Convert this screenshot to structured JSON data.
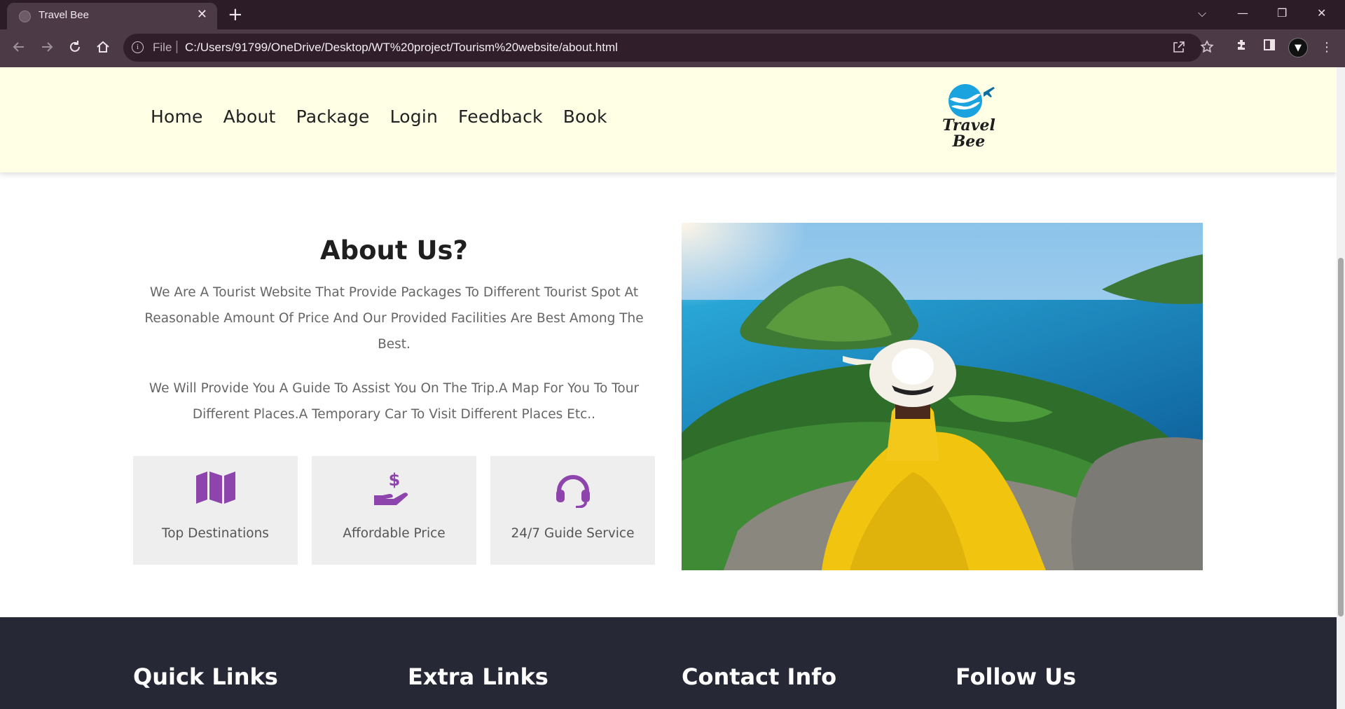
{
  "browser": {
    "tab_title": "Travel Bee",
    "tab_close": "✕",
    "new_tab": "+",
    "address_label": "File",
    "address_sep": "|",
    "url": "C:/Users/91799/OneDrive/Desktop/WT%20project/Tourism%20website/about.html",
    "window_controls": [
      "⌵",
      "—",
      "❐",
      "✕"
    ],
    "nav_icons": [
      "back-icon",
      "forward-icon",
      "reload-icon",
      "home-icon"
    ],
    "toolbar_icons": [
      "share-icon",
      "star-icon",
      "extensions-icon",
      "sidebar-icon",
      "profile-icon",
      "menu-icon"
    ]
  },
  "header": {
    "nav": [
      "Home",
      "About",
      "Package",
      "Login",
      "Feedback",
      "Book"
    ],
    "logo_line1": "Travel",
    "logo_line2": "Bee"
  },
  "about": {
    "title": "About Us?",
    "paragraph1": "We Are A Tourist Website That Provide Packages To Different Tourist Spot At Reasonable Amount Of Price And Our Provided Facilities Are Best Among The Best.",
    "paragraph2": "We Will Provide You A Guide To Assist You On The Trip.A Map For You To Tour Different Places.A Temporary Car To Visit Different Places Etc..",
    "features": [
      {
        "label": "Top Destinations",
        "icon": "map-icon"
      },
      {
        "label": "Affordable Price",
        "icon": "hand-dollar-icon"
      },
      {
        "label": "24/7 Guide Service",
        "icon": "headset-icon"
      }
    ],
    "image_alt": "woman-in-yellow-dress-overlooking-island"
  },
  "footer": {
    "headings": [
      "Quick Links",
      "Extra Links",
      "Contact Info",
      "Follow Us"
    ]
  },
  "colors": {
    "accent": "#8e44ad",
    "header_bg": "#ffffe6",
    "footer_bg": "#262935",
    "chrome_dark": "#2b1c27",
    "chrome_mid": "#4c3a46"
  }
}
